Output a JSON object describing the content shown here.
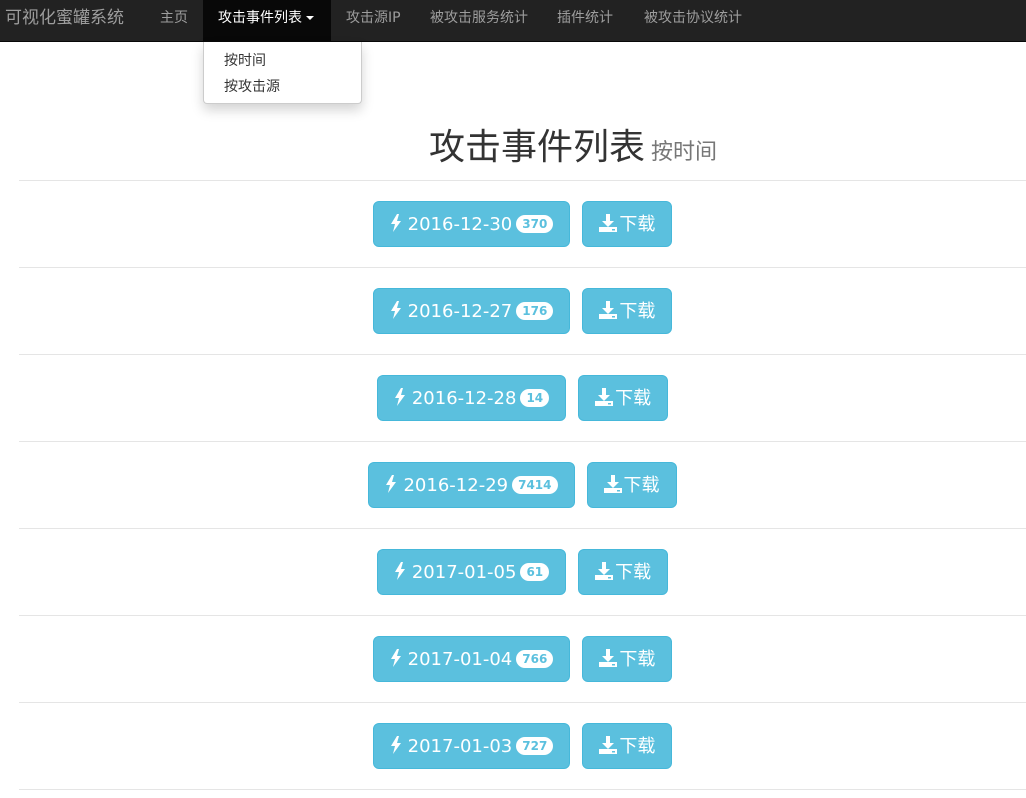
{
  "navbar": {
    "brand": "可视化蜜罐系统",
    "items": [
      {
        "label": "主页"
      },
      {
        "label": "攻击事件列表"
      },
      {
        "label": "攻击源IP"
      },
      {
        "label": "被攻击服务统计"
      },
      {
        "label": "插件统计"
      },
      {
        "label": "被攻击协议统计"
      }
    ]
  },
  "dropdown": {
    "items": [
      {
        "label": "按时间"
      },
      {
        "label": "按攻击源"
      }
    ]
  },
  "page": {
    "title": "攻击事件列表",
    "subtitle": "按时间"
  },
  "icons": {
    "date_button": "bolt-icon",
    "download_button": "download-icon"
  },
  "colors": {
    "info": "#5bc0de",
    "navbar": "#222222"
  },
  "events": [
    {
      "date": "2016-12-30",
      "count": "370",
      "download_label": "下载"
    },
    {
      "date": "2016-12-27",
      "count": "176",
      "download_label": "下载"
    },
    {
      "date": "2016-12-28",
      "count": "14",
      "download_label": "下载"
    },
    {
      "date": "2016-12-29",
      "count": "7414",
      "download_label": "下载"
    },
    {
      "date": "2017-01-05",
      "count": "61",
      "download_label": "下载"
    },
    {
      "date": "2017-01-04",
      "count": "766",
      "download_label": "下载"
    },
    {
      "date": "2017-01-03",
      "count": "727",
      "download_label": "下载"
    }
  ]
}
